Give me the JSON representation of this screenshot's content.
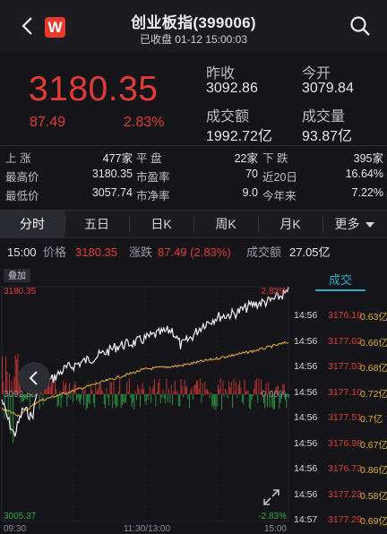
{
  "header": {
    "title": "创业板指(399006)",
    "status": "已收盘 01-12 15:00:03",
    "logo_letter": "W",
    "back_icon": "chevron-left-icon",
    "search_icon": "search-icon"
  },
  "quote": {
    "price": "3180.35",
    "change": "87.49",
    "change_pct": "2.83%",
    "prev_close_label": "昨收",
    "prev_close": "3092.86",
    "open_label": "今开",
    "open": "3079.84",
    "turnover_label": "成交额",
    "turnover": "1992.72亿",
    "volume_label": "成交量",
    "volume": "93.87亿"
  },
  "stats": [
    [
      {
        "label": "上 涨",
        "value": "477家"
      },
      {
        "label": "平 盘",
        "value": "22家"
      },
      {
        "label": "下 跌",
        "value": "395家"
      }
    ],
    [
      {
        "label": "最高价",
        "value": "3180.35"
      },
      {
        "label": "市盈率",
        "value": "70"
      },
      {
        "label": "近20日",
        "value": "16.64%"
      }
    ],
    [
      {
        "label": "最低价",
        "value": "3057.74"
      },
      {
        "label": "市净率",
        "value": "9.0"
      },
      {
        "label": "今年来",
        "value": "7.22%"
      }
    ]
  ],
  "tabs": [
    "分时",
    "五日",
    "日K",
    "周K",
    "月K",
    "更多"
  ],
  "active_tab": "分时",
  "infobar": {
    "time": "15:00",
    "price_label": "价格",
    "price": "3180.35",
    "change_label": "涨跌",
    "change": "87.49 (2.83%)",
    "amount_label": "成交额",
    "amount": "27.05亿"
  },
  "chart": {
    "overlay_label": "叠加",
    "y_max": "3180.35",
    "y_mid": "3092.86",
    "y_min": "3005.37",
    "pct_max": "2.83%",
    "pct_mid": "0.00%",
    "pct_min": "-2.83%",
    "x_ticks": [
      "09:30",
      "11:30/13:00",
      "15:00"
    ]
  },
  "deals": {
    "title": "成交",
    "rows": [
      {
        "time": "14:56",
        "price": "3176.19",
        "vol": "0.63亿"
      },
      {
        "time": "14:56",
        "price": "3177.02",
        "vol": "0.66亿"
      },
      {
        "time": "14:56",
        "price": "3177.03",
        "vol": "0.68亿"
      },
      {
        "time": "14:56",
        "price": "3177.10",
        "vol": "0.72亿"
      },
      {
        "time": "14:56",
        "price": "3177.51",
        "vol": "0.7亿"
      },
      {
        "time": "14:56",
        "price": "3176.98",
        "vol": "0.67亿"
      },
      {
        "time": "14:56",
        "price": "3176.73",
        "vol": "0.86亿"
      },
      {
        "time": "14:56",
        "price": "3177.23",
        "vol": "0.58亿"
      },
      {
        "time": "14:57",
        "price": "3177.29",
        "vol": "0.69亿"
      }
    ]
  },
  "colors": {
    "up": "#e23b36",
    "down": "#2fae4a",
    "accent": "#28b0c8",
    "avg_line": "#d9a531",
    "price_line": "#f2f2f2"
  }
}
